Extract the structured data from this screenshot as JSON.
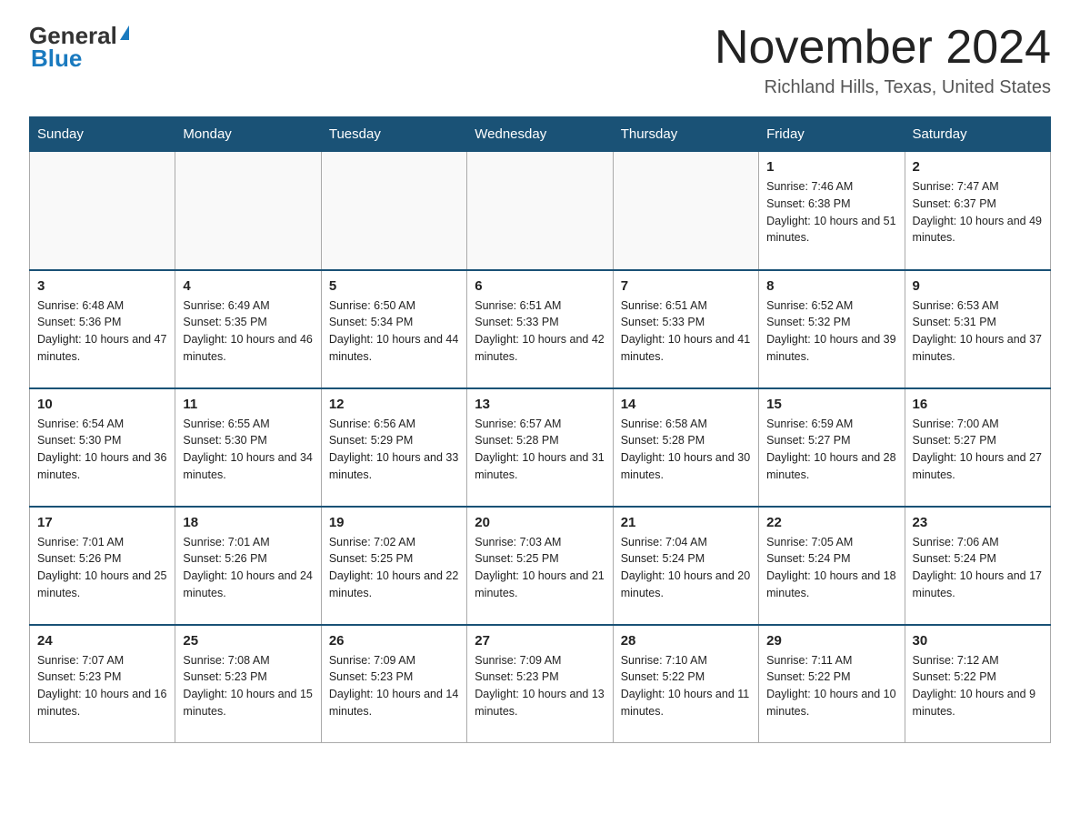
{
  "logo": {
    "general": "General",
    "blue": "Blue"
  },
  "title": "November 2024",
  "location": "Richland Hills, Texas, United States",
  "weekdays": [
    "Sunday",
    "Monday",
    "Tuesday",
    "Wednesday",
    "Thursday",
    "Friday",
    "Saturday"
  ],
  "weeks": [
    [
      {
        "day": "",
        "sunrise": "",
        "sunset": "",
        "daylight": ""
      },
      {
        "day": "",
        "sunrise": "",
        "sunset": "",
        "daylight": ""
      },
      {
        "day": "",
        "sunrise": "",
        "sunset": "",
        "daylight": ""
      },
      {
        "day": "",
        "sunrise": "",
        "sunset": "",
        "daylight": ""
      },
      {
        "day": "",
        "sunrise": "",
        "sunset": "",
        "daylight": ""
      },
      {
        "day": "1",
        "sunrise": "Sunrise: 7:46 AM",
        "sunset": "Sunset: 6:38 PM",
        "daylight": "Daylight: 10 hours and 51 minutes."
      },
      {
        "day": "2",
        "sunrise": "Sunrise: 7:47 AM",
        "sunset": "Sunset: 6:37 PM",
        "daylight": "Daylight: 10 hours and 49 minutes."
      }
    ],
    [
      {
        "day": "3",
        "sunrise": "Sunrise: 6:48 AM",
        "sunset": "Sunset: 5:36 PM",
        "daylight": "Daylight: 10 hours and 47 minutes."
      },
      {
        "day": "4",
        "sunrise": "Sunrise: 6:49 AM",
        "sunset": "Sunset: 5:35 PM",
        "daylight": "Daylight: 10 hours and 46 minutes."
      },
      {
        "day": "5",
        "sunrise": "Sunrise: 6:50 AM",
        "sunset": "Sunset: 5:34 PM",
        "daylight": "Daylight: 10 hours and 44 minutes."
      },
      {
        "day": "6",
        "sunrise": "Sunrise: 6:51 AM",
        "sunset": "Sunset: 5:33 PM",
        "daylight": "Daylight: 10 hours and 42 minutes."
      },
      {
        "day": "7",
        "sunrise": "Sunrise: 6:51 AM",
        "sunset": "Sunset: 5:33 PM",
        "daylight": "Daylight: 10 hours and 41 minutes."
      },
      {
        "day": "8",
        "sunrise": "Sunrise: 6:52 AM",
        "sunset": "Sunset: 5:32 PM",
        "daylight": "Daylight: 10 hours and 39 minutes."
      },
      {
        "day": "9",
        "sunrise": "Sunrise: 6:53 AM",
        "sunset": "Sunset: 5:31 PM",
        "daylight": "Daylight: 10 hours and 37 minutes."
      }
    ],
    [
      {
        "day": "10",
        "sunrise": "Sunrise: 6:54 AM",
        "sunset": "Sunset: 5:30 PM",
        "daylight": "Daylight: 10 hours and 36 minutes."
      },
      {
        "day": "11",
        "sunrise": "Sunrise: 6:55 AM",
        "sunset": "Sunset: 5:30 PM",
        "daylight": "Daylight: 10 hours and 34 minutes."
      },
      {
        "day": "12",
        "sunrise": "Sunrise: 6:56 AM",
        "sunset": "Sunset: 5:29 PM",
        "daylight": "Daylight: 10 hours and 33 minutes."
      },
      {
        "day": "13",
        "sunrise": "Sunrise: 6:57 AM",
        "sunset": "Sunset: 5:28 PM",
        "daylight": "Daylight: 10 hours and 31 minutes."
      },
      {
        "day": "14",
        "sunrise": "Sunrise: 6:58 AM",
        "sunset": "Sunset: 5:28 PM",
        "daylight": "Daylight: 10 hours and 30 minutes."
      },
      {
        "day": "15",
        "sunrise": "Sunrise: 6:59 AM",
        "sunset": "Sunset: 5:27 PM",
        "daylight": "Daylight: 10 hours and 28 minutes."
      },
      {
        "day": "16",
        "sunrise": "Sunrise: 7:00 AM",
        "sunset": "Sunset: 5:27 PM",
        "daylight": "Daylight: 10 hours and 27 minutes."
      }
    ],
    [
      {
        "day": "17",
        "sunrise": "Sunrise: 7:01 AM",
        "sunset": "Sunset: 5:26 PM",
        "daylight": "Daylight: 10 hours and 25 minutes."
      },
      {
        "day": "18",
        "sunrise": "Sunrise: 7:01 AM",
        "sunset": "Sunset: 5:26 PM",
        "daylight": "Daylight: 10 hours and 24 minutes."
      },
      {
        "day": "19",
        "sunrise": "Sunrise: 7:02 AM",
        "sunset": "Sunset: 5:25 PM",
        "daylight": "Daylight: 10 hours and 22 minutes."
      },
      {
        "day": "20",
        "sunrise": "Sunrise: 7:03 AM",
        "sunset": "Sunset: 5:25 PM",
        "daylight": "Daylight: 10 hours and 21 minutes."
      },
      {
        "day": "21",
        "sunrise": "Sunrise: 7:04 AM",
        "sunset": "Sunset: 5:24 PM",
        "daylight": "Daylight: 10 hours and 20 minutes."
      },
      {
        "day": "22",
        "sunrise": "Sunrise: 7:05 AM",
        "sunset": "Sunset: 5:24 PM",
        "daylight": "Daylight: 10 hours and 18 minutes."
      },
      {
        "day": "23",
        "sunrise": "Sunrise: 7:06 AM",
        "sunset": "Sunset: 5:24 PM",
        "daylight": "Daylight: 10 hours and 17 minutes."
      }
    ],
    [
      {
        "day": "24",
        "sunrise": "Sunrise: 7:07 AM",
        "sunset": "Sunset: 5:23 PM",
        "daylight": "Daylight: 10 hours and 16 minutes."
      },
      {
        "day": "25",
        "sunrise": "Sunrise: 7:08 AM",
        "sunset": "Sunset: 5:23 PM",
        "daylight": "Daylight: 10 hours and 15 minutes."
      },
      {
        "day": "26",
        "sunrise": "Sunrise: 7:09 AM",
        "sunset": "Sunset: 5:23 PM",
        "daylight": "Daylight: 10 hours and 14 minutes."
      },
      {
        "day": "27",
        "sunrise": "Sunrise: 7:09 AM",
        "sunset": "Sunset: 5:23 PM",
        "daylight": "Daylight: 10 hours and 13 minutes."
      },
      {
        "day": "28",
        "sunrise": "Sunrise: 7:10 AM",
        "sunset": "Sunset: 5:22 PM",
        "daylight": "Daylight: 10 hours and 11 minutes."
      },
      {
        "day": "29",
        "sunrise": "Sunrise: 7:11 AM",
        "sunset": "Sunset: 5:22 PM",
        "daylight": "Daylight: 10 hours and 10 minutes."
      },
      {
        "day": "30",
        "sunrise": "Sunrise: 7:12 AM",
        "sunset": "Sunset: 5:22 PM",
        "daylight": "Daylight: 10 hours and 9 minutes."
      }
    ]
  ]
}
